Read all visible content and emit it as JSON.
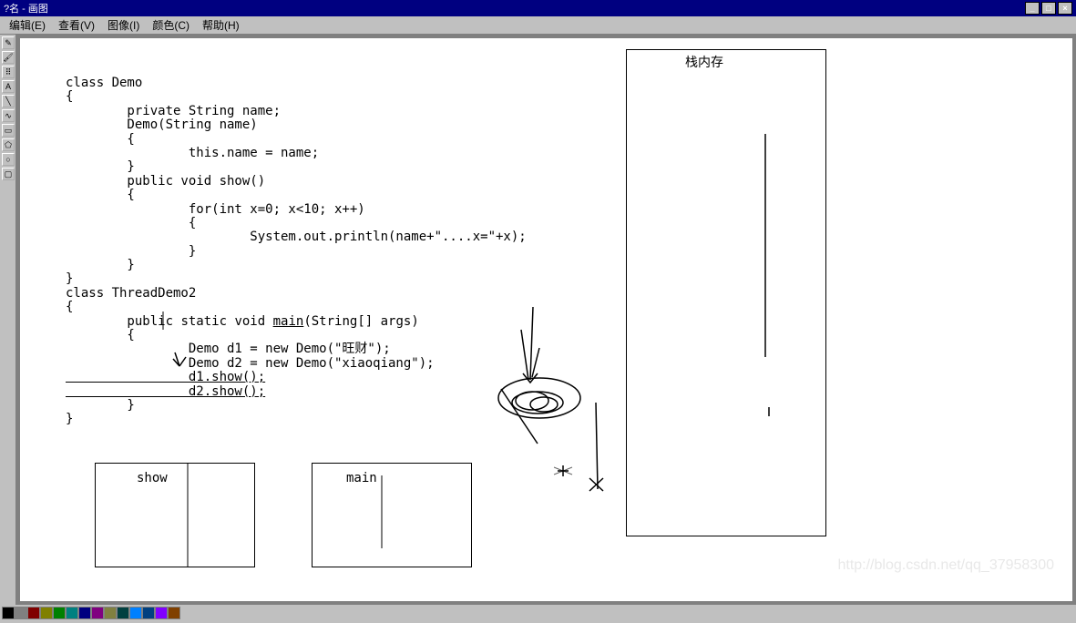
{
  "title": "?名 - 画图",
  "menu": {
    "edit": "编辑(E)",
    "view": "查看(V)",
    "image": "图像(I)",
    "color": "颜色(C)",
    "help": "帮助(H)"
  },
  "stack_label": "栈内存",
  "show_box_label": "show",
  "main_box_label": "main",
  "code": {
    "l1": "class Demo",
    "l2": "{",
    "l3": "        private String name;",
    "l4": "        Demo(String name)",
    "l5": "        {",
    "l6": "                this.name = name;",
    "l7": "        }",
    "l8": "        public void show()",
    "l9": "        {",
    "l10": "                for(int x=0; x<10; x++)",
    "l11": "                {",
    "l12": "                        System.out.println(name+\"....x=\"+x);",
    "l13": "                }",
    "l14": "        }",
    "l15": "}",
    "l16": "class ThreadDemo2",
    "l17": "{",
    "l18": "        public",
    "l18b": " static void ",
    "l18c": "main",
    "l18d": "(String[] args)",
    "l19": "        {",
    "l20": "                Demo d1 = new Demo(\"旺财\");",
    "l21": "                Demo d2 = new Demo(\"xiaoqiang\");",
    "l22": "                d1.show();",
    "l23": "                d2.show();",
    "l24": "        }",
    "l25": "}"
  },
  "palette": [
    "#000000",
    "#808080",
    "#800000",
    "#808000",
    "#008000",
    "#008080",
    "#000080",
    "#800080",
    "#808040",
    "#004040",
    "#0080ff",
    "#004080",
    "#8000ff",
    "#804000"
  ],
  "watermark": "http://blog.csdn.net/qq_37958300"
}
